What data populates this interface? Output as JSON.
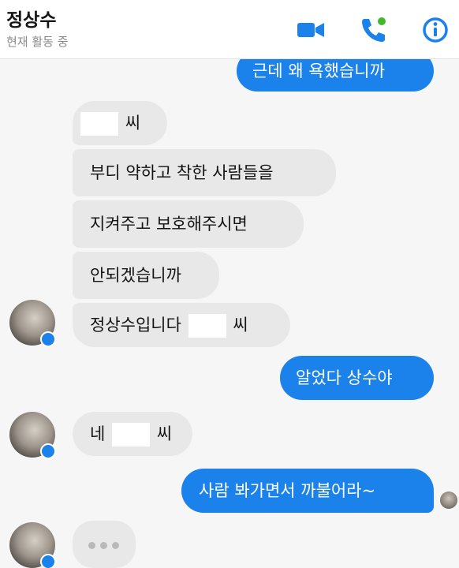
{
  "header": {
    "contact_name": "정상수",
    "status": "현재 활동 중",
    "icons": [
      "video-call-icon",
      "phone-call-icon",
      "info-icon"
    ],
    "accent_color": "#1a82ea"
  },
  "messages": [
    {
      "side": "sent",
      "text": "근데 왜 욕했습니까"
    },
    {
      "side": "received",
      "before": "",
      "after": "씨",
      "redacted": true
    },
    {
      "side": "received",
      "text": "부디 약하고 착한 사람들을"
    },
    {
      "side": "received",
      "text": "지켜주고 보호해주시면"
    },
    {
      "side": "received",
      "text": "안되겠습니까"
    },
    {
      "side": "received",
      "before": "정상수입니다",
      "after": "씨",
      "redacted": true
    },
    {
      "side": "sent",
      "text": "알었다 상수야"
    },
    {
      "side": "received",
      "before": "네",
      "after": "씨",
      "redacted": true
    },
    {
      "side": "sent",
      "text": "사람 봐가면서 까불어라~"
    },
    {
      "side": "received",
      "typing": true
    }
  ],
  "colors": {
    "sent_bubble": "#1a82ea",
    "received_bubble": "#e8e8e8",
    "background": "#f6f6f6"
  }
}
